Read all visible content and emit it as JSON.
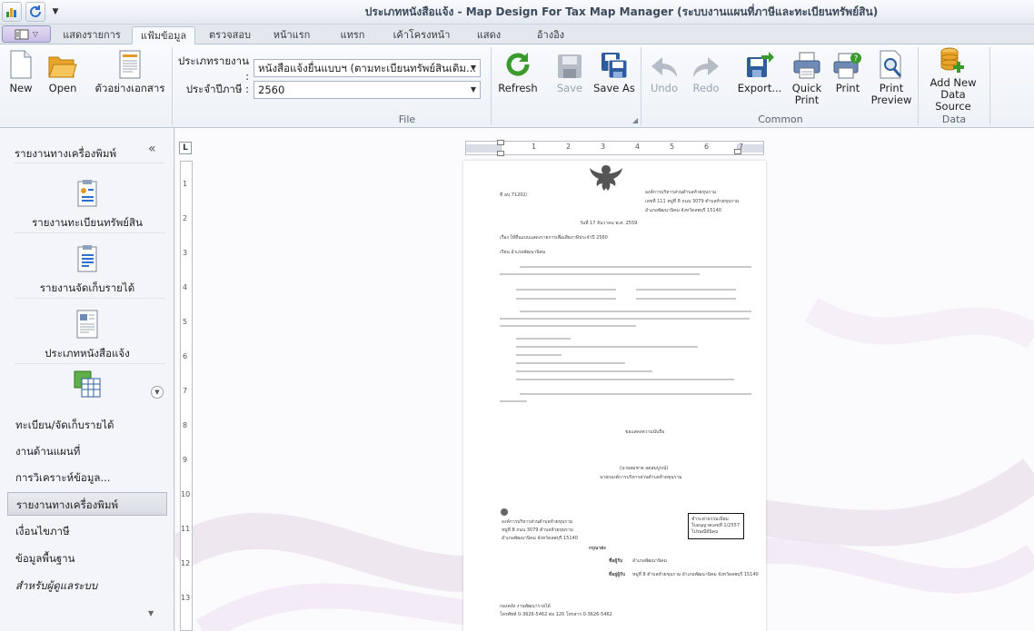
{
  "window": {
    "title": "ประเภทหนังสือแจ้ง - Map Design For Tax Map Manager (ระบบงานแผนที่ภาษีและทะเบียนทรัพย์สิน)"
  },
  "tabs": [
    {
      "label": "แสดงรายการ",
      "active": false
    },
    {
      "label": "แฟ้มข้อมูล",
      "active": true
    },
    {
      "label": "ตรวจสอบ",
      "active": false
    },
    {
      "label": "หน้าแรก",
      "active": false
    },
    {
      "label": "แทรก",
      "active": false
    },
    {
      "label": "เค้าโครงหน้า",
      "active": false
    },
    {
      "label": "แสดง",
      "active": false
    },
    {
      "label": "อ้างอิง",
      "active": false
    }
  ],
  "ribbon": {
    "file": {
      "group_label": "File",
      "new_label": "New",
      "open_label": "Open",
      "sample_label": "ตัวอย่างเอกสาร",
      "report_type_label": "ประเภทรายงาน :",
      "report_type_value": "หนังสือแจ้งยื่นแบบฯ (ตามทะเบียนทรัพย์สินเดิม...",
      "year_label": "ประจำปีภาษี :",
      "year_value": "2560",
      "refresh_label": "Refresh",
      "save_label": "Save",
      "save_as_label": "Save As"
    },
    "common": {
      "group_label": "Common",
      "undo_label": "Undo",
      "redo_label": "Redo",
      "export_label": "Export...",
      "quick_print_label": "Quick Print",
      "print_label": "Print",
      "print_preview_label": "Print Preview"
    },
    "data": {
      "group_label": "Data",
      "add_source_label": "Add New Data Source"
    }
  },
  "sidebar": {
    "header": "รายงานทางเครื่องพิมพ์",
    "tiles": [
      {
        "label": "รายงานทะเบียนทรัพย์สิน"
      },
      {
        "label": "รายงานจัดเก็บรายได้"
      },
      {
        "label": "ประเภทหนังสือแจ้ง"
      }
    ],
    "nav": [
      {
        "label": "ทะเบียน/จัดเก็บรายได้",
        "active": false
      },
      {
        "label": "งานด้านแผนที่",
        "active": false
      },
      {
        "label": "การวิเคราะห์ข้อมูล...",
        "active": false
      },
      {
        "label": "รายงานทางเครื่องพิมพ์",
        "active": true
      },
      {
        "label": "เงื่อนไขภาษี",
        "active": false
      },
      {
        "label": "ข้อมูลพื้นฐาน",
        "active": false
      },
      {
        "label": "สำหรับผู้ดูแลระบบ",
        "active": false
      }
    ]
  },
  "document": {
    "corner_label": "L",
    "ruler_h": [
      "1",
      "2",
      "3",
      "4",
      "5",
      "6",
      "7"
    ],
    "ruler_v": [
      "1",
      "2",
      "3",
      "4",
      "5",
      "6",
      "7",
      "8",
      "9",
      "10",
      "11",
      "12",
      "13"
    ],
    "page": {
      "ref_no": "ที่ ลบ 71202/",
      "sender_1": "องค์การบริหารส่วนตำบลห้วยขุนราม",
      "sender_2": "เลขที่ 111 หมู่ที่ 8 ถนน 3079 ตำบลห้วยขุนราม",
      "sender_3": "อำเภอพัฒนานิคม จังหวัดลพบุรี 15140",
      "date": "วันที่ 17 ธันวาคม พ.ศ. 2559",
      "subject": "เรื่อง ให้ยื่นแบบแสดงรายการเพื่อเสียภาษีประจำปี 2560",
      "to": "เรียน อำเภอพัฒนานิคม",
      "signature_1": "ขอแสดงความนับถือ",
      "signature_2": "(นายสมชาย ลดสมบูรณ์)",
      "signature_3": "นายกองค์การบริหารส่วนตำบลห้วยขุนราม",
      "stamp_1": "ชำระค่าธรรมเนียม",
      "stamp_2": "ใบอนุญาตเลขที่ 1/2557",
      "stamp_3": "ไปรษณีย์นิคม",
      "address_1": "องค์การบริหารส่วนตำบลห้วยขุนราม",
      "address_2": "หมู่ที่ 8 ถนน 3079 ตำบลห้วยขุนราม",
      "address_3": "อำเภอพัฒนานิคม จังหวัดลพบุรี 15140",
      "send_label": "กรุณาส่ง",
      "recipient_label": "ชื่อผู้รับ",
      "recipient_name": "อำเภอพัฒนานิคม",
      "address_label": "ที่อยู่ผู้รับ",
      "recipient_address": "หมู่ที่ 8 ตำบลห้วยขุนราม อำเภอพัฒนานิคม จังหวัดลพบุรี 15140",
      "footer_1": "กองคลัง งานพัฒนารายได้",
      "footer_2": "โทรศัพท์ 0-3626-5462 ต่อ 120 โทรสาร 0-3626-5462"
    }
  },
  "colors": {
    "accent": "#2c8bd0",
    "active_tab_bg": "#f7f9fc",
    "sidebar_bg": "#f3f5f8"
  }
}
